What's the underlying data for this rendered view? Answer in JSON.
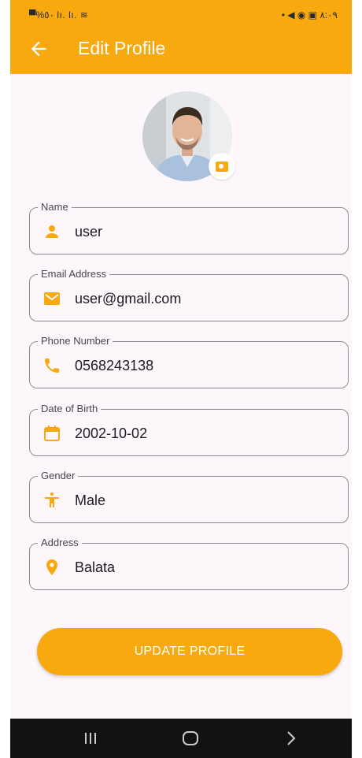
{
  "status_bar": {
    "left": "▀%٥٠ lı. lı. ≋",
    "right": "• ◀ ◉ ▣ ٨:٠٩"
  },
  "app_bar": {
    "title": "Edit Profile",
    "back_icon": "arrow-left-icon",
    "color": "#f8a90f"
  },
  "profile": {
    "avatar_icon": "user-photo",
    "camera_icon": "camera-icon"
  },
  "fields": [
    {
      "label": "Name",
      "value": "user",
      "icon": "person-icon"
    },
    {
      "label": "Email Address",
      "value": "user@gmail.com",
      "icon": "email-icon"
    },
    {
      "label": "Phone Number",
      "value": "0568243138",
      "icon": "phone-icon"
    },
    {
      "label": "Date of Birth",
      "value": "2002-10-02",
      "icon": "calendar-icon"
    },
    {
      "label": "Gender",
      "value": "Male",
      "icon": "accessibility-icon"
    },
    {
      "label": "Address",
      "value": "Balata",
      "icon": "location-pin-icon"
    }
  ],
  "update_button": {
    "label": "UPDATE PROFILE"
  },
  "nav_bar": {
    "icons": [
      "recent-apps-icon",
      "home-icon",
      "back-icon"
    ]
  }
}
